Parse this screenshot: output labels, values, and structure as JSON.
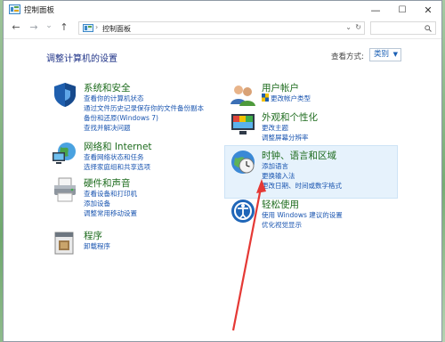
{
  "window": {
    "title": "控制面板"
  },
  "address": {
    "path": "控制面板"
  },
  "controls": {
    "minimize": "—",
    "maximize": "☐",
    "close": "✕"
  },
  "nav": {
    "back": "←",
    "forward": "→",
    "dropdown": "⌄",
    "up": "↑"
  },
  "heading": "调整计算机的设置",
  "view_by": {
    "label": "查看方式:",
    "value": "类别"
  },
  "categories": {
    "system": {
      "title": "系统和安全",
      "links": [
        "查看你的计算机状态",
        "通过文件历史记录保存你的文件备份副本",
        "备份和还原(Windows 7)",
        "查找并解决问题"
      ]
    },
    "network": {
      "title": "网络和 Internet",
      "links": [
        "查看网络状态和任务",
        "选择家庭组和共享选项"
      ]
    },
    "hardware": {
      "title": "硬件和声音",
      "links": [
        "查看设备和打印机",
        "添加设备",
        "调整常用移动设置"
      ]
    },
    "programs": {
      "title": "程序",
      "links": [
        "卸载程序"
      ]
    },
    "user": {
      "title": "用户帐户",
      "links": [
        "更改帐户类型"
      ]
    },
    "appearance": {
      "title": "外观和个性化",
      "links": [
        "更改主题",
        "调整屏幕分辨率"
      ]
    },
    "clock": {
      "title": "时钟、语言和区域",
      "links": [
        "添加语言",
        "更换输入法",
        "更改日期、时间或数字格式"
      ]
    },
    "ease": {
      "title": "轻松使用",
      "links": [
        "使用 Windows 建议的设置",
        "优化视觉显示"
      ]
    }
  },
  "colors": {
    "link": "#1a55b0",
    "title_green": "#1d6b1d",
    "annotation": "#e53935",
    "highlight": "#e6f2fc"
  }
}
